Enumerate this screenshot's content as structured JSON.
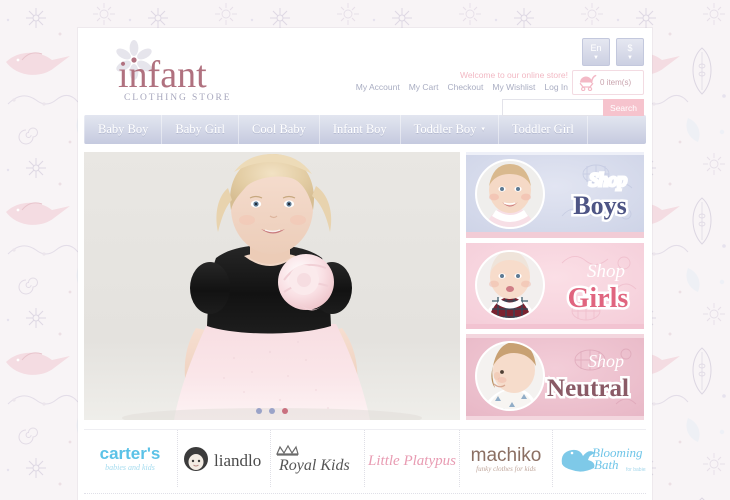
{
  "site": {
    "logo_word": "infant",
    "logo_sub": "CLOTHING STORE",
    "flower_icon": "flower-icon"
  },
  "header": {
    "language": {
      "label": "En",
      "caret": "▼",
      "icon": "chevron-down-icon"
    },
    "currency": {
      "label": "$",
      "caret": "▼",
      "icon": "chevron-down-icon"
    },
    "welcome": "Welcome to our online store!",
    "links": [
      {
        "label": "My Account"
      },
      {
        "label": "My Cart"
      },
      {
        "label": "Checkout"
      },
      {
        "label": "My Wishlist"
      },
      {
        "label": "Log In"
      }
    ],
    "cart": {
      "icon": "stroller-icon",
      "count_label": "0 item(s)"
    },
    "search": {
      "value": "",
      "placeholder": "",
      "button_label": "Search"
    }
  },
  "nav": {
    "items": [
      {
        "label": "Baby Boy",
        "has_dropdown": false
      },
      {
        "label": "Baby Girl",
        "has_dropdown": false
      },
      {
        "label": "Cool Baby",
        "has_dropdown": false
      },
      {
        "label": "Infant Boy",
        "has_dropdown": false
      },
      {
        "label": "Toddler Boy",
        "has_dropdown": true,
        "caret": "▾"
      },
      {
        "label": "Toddler Girl",
        "has_dropdown": false
      }
    ]
  },
  "hero": {
    "alt": "toddler girl in black velvet and pink tulle dress",
    "dots": [
      {
        "state": "inactive",
        "color": "#9aa3c8"
      },
      {
        "state": "inactive",
        "color": "#9aa3c8"
      },
      {
        "state": "active",
        "color": "#c9707f"
      }
    ]
  },
  "banners": [
    {
      "shop_label": "Shop",
      "category_label": "Boys",
      "bg": "#d8dbeb",
      "text_color": "#4e5585",
      "alt": "smiling baby boy in pink polo shirt"
    },
    {
      "shop_label": "Shop",
      "category_label": "Girls",
      "bg": "#f6d3dc",
      "text_color": "#e0657f",
      "alt": "baby girl in plaid tartan dress"
    },
    {
      "shop_label": "Shop",
      "category_label": "Neutral",
      "bg": "#eebfcb",
      "text_color": "#8a5a66",
      "alt": "baby in profile wearing printed sleepsuit"
    }
  ],
  "brands": [
    {
      "name": "carter's",
      "tagline": "babies and kids",
      "color": "#5bc2e7",
      "tagline_color": "#9fd9ef"
    },
    {
      "name": "liandlo",
      "tagline": "",
      "color": "#4a4a4a",
      "tagline_color": ""
    },
    {
      "name": "Royal Kids",
      "tagline": "",
      "color": "#5a5a5a",
      "tagline_color": ""
    },
    {
      "name": "Little Platypus",
      "tagline": "",
      "color": "#e89bb2",
      "tagline_color": ""
    },
    {
      "name": "machiko",
      "tagline": "funky clothes for kids",
      "color": "#8b6f63",
      "tagline_color": "#c0a79c"
    },
    {
      "name": "Blooming Bath",
      "tagline": "for babies",
      "color": "#6fc5e8",
      "tagline_color": "#a7d8ec"
    }
  ],
  "colors": {
    "accent_pink": "#f6c3cd",
    "logo_rose": "#b0717f",
    "nav_lavender": "#c5cadf",
    "page_bg": "#f7f3f5"
  }
}
